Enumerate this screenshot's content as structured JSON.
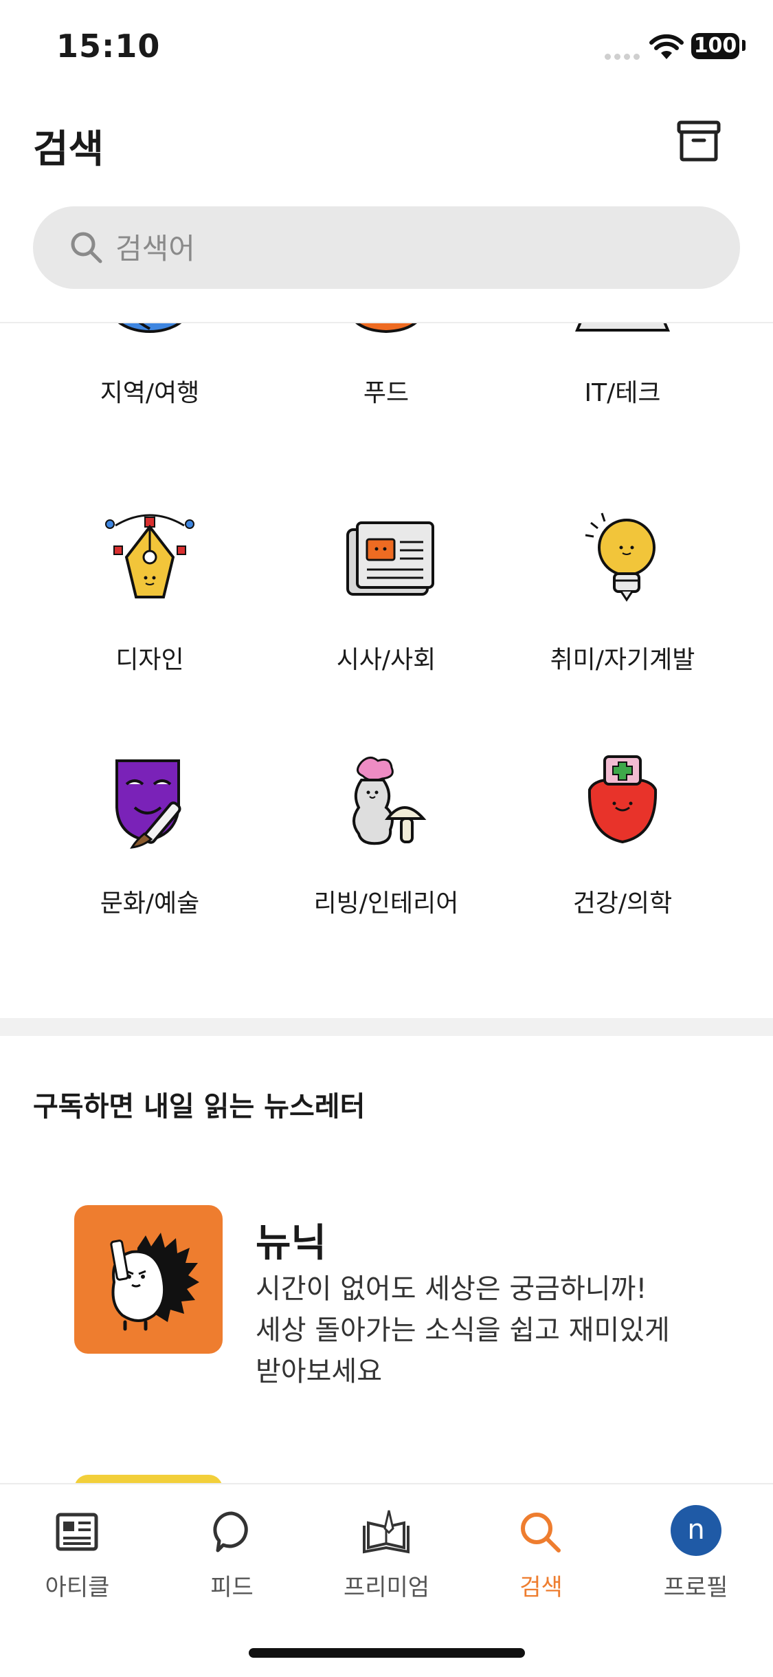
{
  "status_bar": {
    "time": "15:10",
    "battery": "100"
  },
  "header": {
    "title": "검색"
  },
  "search": {
    "placeholder": "검색어"
  },
  "categories": [
    {
      "label": "지역/여행",
      "icon": "globe-icon"
    },
    {
      "label": "푸드",
      "icon": "food-icon"
    },
    {
      "label": "IT/테크",
      "icon": "keyboard-icon"
    },
    {
      "label": "디자인",
      "icon": "pen-tool-icon"
    },
    {
      "label": "시사/사회",
      "icon": "newspaper-icon"
    },
    {
      "label": "취미/자기계발",
      "icon": "lightbulb-icon"
    },
    {
      "label": "문화/예술",
      "icon": "mask-icon"
    },
    {
      "label": "리빙/인테리어",
      "icon": "plant-icon"
    },
    {
      "label": "건강/의학",
      "icon": "apple-medical-icon"
    }
  ],
  "section": {
    "title": "구독하면 내일 읽는 뉴스레터"
  },
  "newsletters": [
    {
      "name": "뉴닉",
      "description_lines": [
        "시간이 없어도 세상은 궁금하니까!",
        "세상 돌아가는 소식을 쉽고 재미있게",
        "받아보세요"
      ],
      "color": "#EE7D2F"
    }
  ],
  "tabs": [
    {
      "label": "아티클",
      "icon": "article-icon"
    },
    {
      "label": "피드",
      "icon": "feed-bubble-icon"
    },
    {
      "label": "프리미엄",
      "icon": "premium-book-icon"
    },
    {
      "label": "검색",
      "icon": "search-icon"
    },
    {
      "label": "프로필",
      "icon": "avatar"
    }
  ],
  "profile": {
    "avatar_letter": "n"
  },
  "colors": {
    "accent": "#EE7D2F",
    "avatar": "#1F5AA6"
  }
}
